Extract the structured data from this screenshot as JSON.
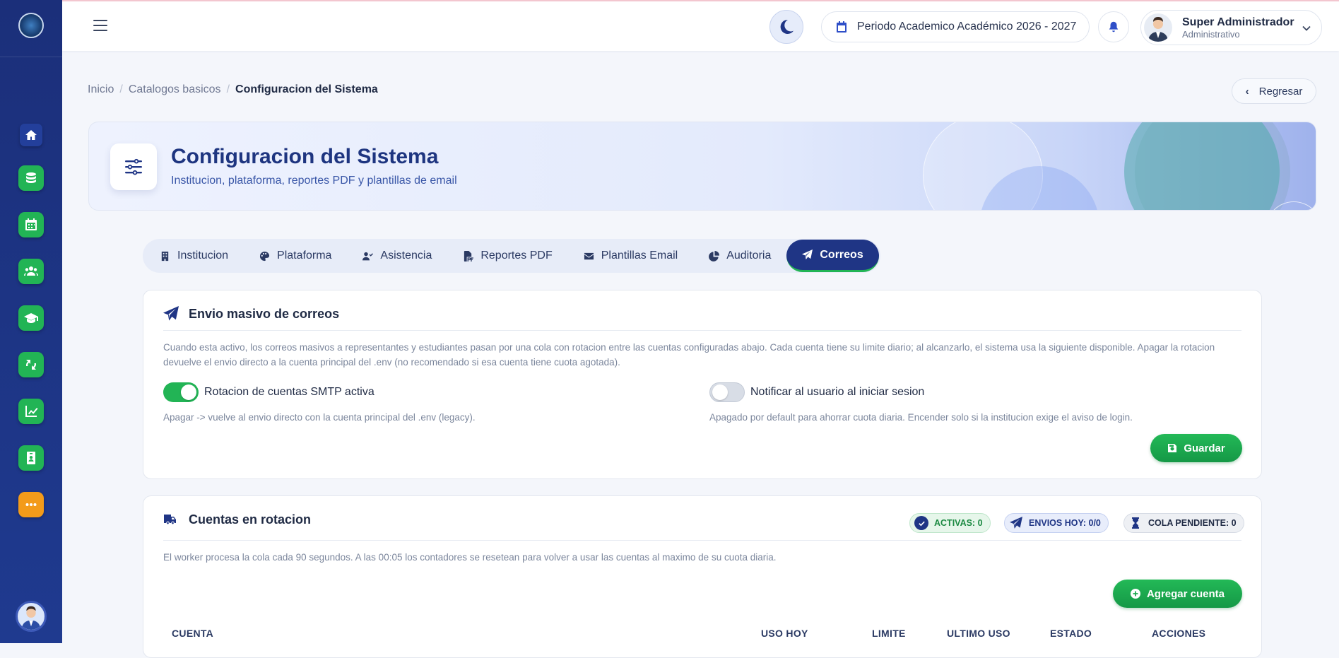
{
  "topbar": {
    "period_label": "Periodo Academico Académico 2026 - 2027",
    "user_name": "Super Administrador",
    "user_role": "Administrativo"
  },
  "breadcrumb": {
    "items": [
      "Inicio",
      "Catalogos basicos",
      "Configuracion del Sistema"
    ]
  },
  "back_label": "Regresar",
  "hero": {
    "title": "Configuracion del Sistema",
    "subtitle": "Institucion, plataforma, reportes PDF y plantillas de email"
  },
  "tabs": [
    {
      "label": "Institucion",
      "icon": "building-icon"
    },
    {
      "label": "Plataforma",
      "icon": "palette-icon"
    },
    {
      "label": "Asistencia",
      "icon": "user-check-icon"
    },
    {
      "label": "Reportes PDF",
      "icon": "file-pdf-icon"
    },
    {
      "label": "Plantillas Email",
      "icon": "envelope-icon"
    },
    {
      "label": "Auditoria",
      "icon": "chart-pie-icon"
    },
    {
      "label": "Correos",
      "icon": "paper-plane-icon",
      "active": true
    }
  ],
  "envio": {
    "title": "Envio masivo de correos",
    "description": "Cuando esta activo, los correos masivos a representantes y estudiantes pasan por una cola con rotacion entre las cuentas configuradas abajo. Cada cuenta tiene su limite diario; al alcanzarlo, el sistema usa la siguiente disponible. Apagar la rotacion devuelve el envio directo a la cuenta principal del .env (no recomendado si esa cuenta tiene cuota agotada).",
    "rotation_label": "Rotacion de cuentas SMTP activa",
    "rotation_on": true,
    "rotation_hint": "Apagar -> vuelve al envio directo con la cuenta principal del .env (legacy).",
    "notify_label": "Notificar al usuario al iniciar sesion",
    "notify_on": false,
    "notify_hint": "Apagado por default para ahorrar cuota diaria. Encender solo si la institucion exige el aviso de login.",
    "save_label": "Guardar"
  },
  "cuentas": {
    "title": "Cuentas en rotacion",
    "badge_active": "ACTIVAS: 0",
    "badge_envios": "ENVIOS HOY: 0/0",
    "badge_cola": "COLA PENDIENTE: 0",
    "description": "El worker procesa la cola cada 90 segundos. A las 00:05 los contadores se resetean para volver a usar las cuentas al maximo de su cuota diaria.",
    "add_label": "Agregar cuenta",
    "columns": [
      "CUENTA",
      "USO HOY",
      "LIMITE",
      "ULTIMO USO",
      "ESTADO",
      "ACCIONES"
    ]
  },
  "colors": {
    "sidebar": "#1f3a8f",
    "primary": "#1f3585",
    "success": "#22b455",
    "warning": "#f39b1a"
  }
}
